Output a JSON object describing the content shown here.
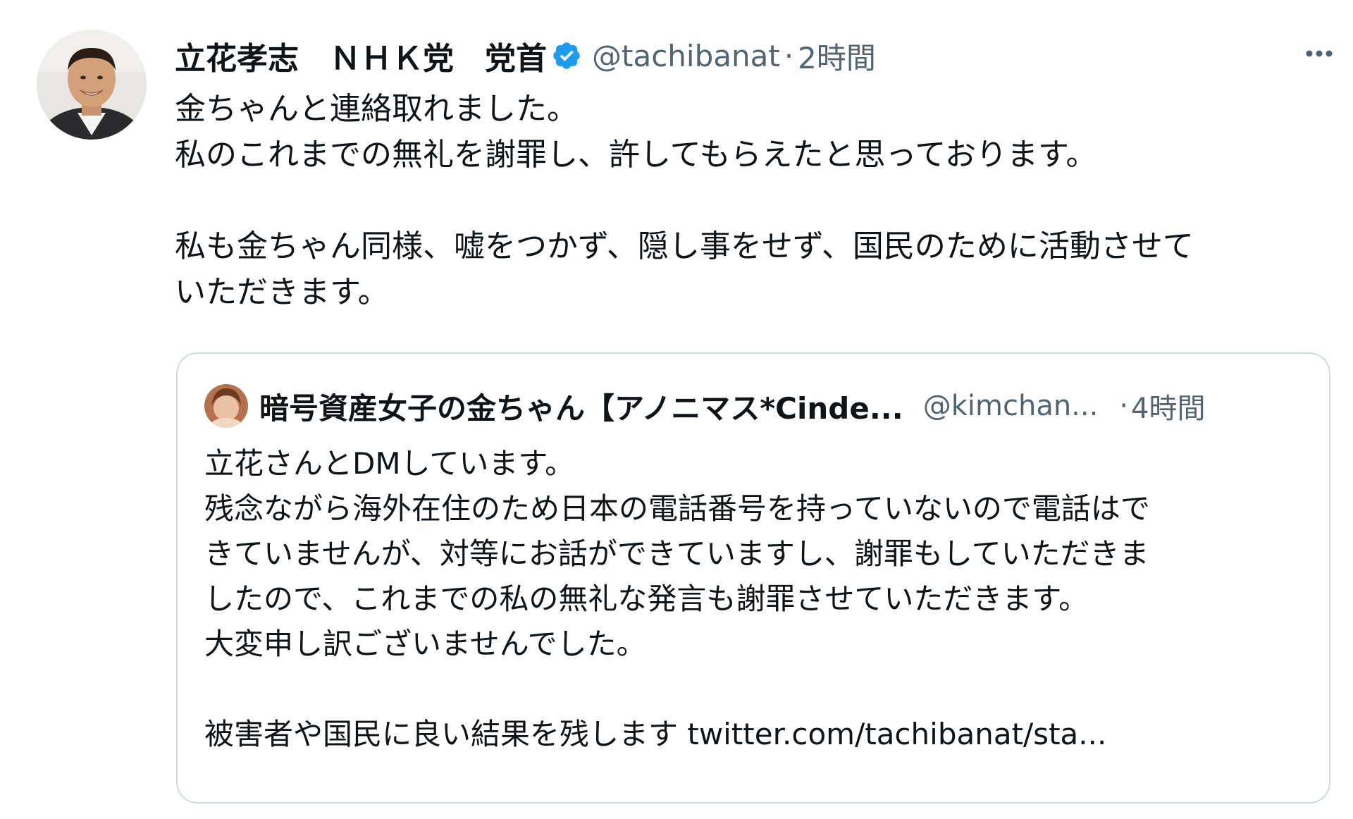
{
  "tweet": {
    "author_name": "立花孝志　ＮＨＫ党　党首",
    "handle": "@tachibanat",
    "separator": "·",
    "time": "2時間",
    "more_label": "···",
    "text_lines": [
      "金ちゃんと連絡取れました。",
      "私のこれまでの無礼を謝罪し、許してもらえたと思っております。",
      "",
      "私も金ちゃん同様、嘘をつかず、隠し事をせず、国民のために活動させて",
      "いただきます。"
    ]
  },
  "quoted_tweet": {
    "author_name": "暗号資産女子の金ちゃん【アノニマス*Cinde...",
    "handle": "@kimchan...",
    "separator": "·",
    "time": "4時間",
    "text_lines": [
      "立花さんとDMしています。",
      "残念ながら海外在住のため日本の電話番号を持っていないので電話はで",
      "きていませんが、対等にお話ができていますし、謝罪もしていただきま",
      "したので、これまでの私の無礼な発言も謝罪させていただきます。",
      "大変申し訳ございませんでした。",
      "",
      "被害者や国民に良い結果を残します twitter.com/tachibanat/sta..."
    ]
  },
  "colors": {
    "text_primary": "#0f1419",
    "text_secondary": "#536471",
    "verified_blue": "#1d9bf0",
    "border": "#cfd9de"
  },
  "icons": {
    "verified": "verified-badge-icon",
    "more": "more-options-icon"
  }
}
